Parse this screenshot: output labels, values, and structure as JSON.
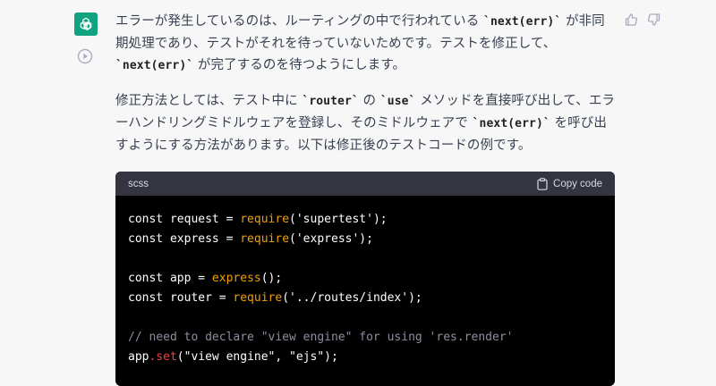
{
  "colors": {
    "accent": "#10a37f",
    "code_bg": "#000000",
    "code_header_bg": "#343541",
    "fn": "#f0a000",
    "method": "#ef4146",
    "comment": "#8e8ea0"
  },
  "icons": [
    "openai-logo-icon",
    "play-icon",
    "thumbs-up-icon",
    "thumbs-down-icon",
    "clipboard-icon"
  ],
  "message": {
    "p1": [
      {
        "t": "エラーが発生しているのは、ルーティングの中で行われている "
      },
      {
        "c": "`next(err)`"
      },
      {
        "t": " が非同期処理であり、テストがそれを待っていないためです。テストを修正して、 "
      },
      {
        "c": "`next(err)`"
      },
      {
        "t": " が完了するのを待つようにします。"
      }
    ],
    "p2": [
      {
        "t": "修正方法としては、テスト中に "
      },
      {
        "c": "`router`"
      },
      {
        "t": " の "
      },
      {
        "c": "`use`"
      },
      {
        "t": " メソッドを直接呼び出して、エラーハンドリングミドルウェアを登録し、そのミドルウェアで "
      },
      {
        "c": "`next(err)`"
      },
      {
        "t": " を呼び出すようにする方法があります。以下は修正後のテストコードの例です。"
      }
    ]
  },
  "codeblock": {
    "language": "scss",
    "copy_label": "Copy code",
    "lines": [
      [
        {
          "t": "const request = "
        },
        {
          "f": "require"
        },
        {
          "t": "('supertest');"
        }
      ],
      [
        {
          "t": "const express = "
        },
        {
          "f": "require"
        },
        {
          "t": "('express');"
        }
      ],
      [],
      [
        {
          "t": "const app = "
        },
        {
          "f": "express"
        },
        {
          "t": "();"
        }
      ],
      [
        {
          "t": "const router = "
        },
        {
          "f": "require"
        },
        {
          "t": "('../routes/index');"
        }
      ],
      [],
      [
        {
          "cm": "// need to declare \"view engine\" for using 'res.render'"
        }
      ],
      [
        {
          "t": "app"
        },
        {
          "r": ".set"
        },
        {
          "t": "(\"view engine\", \"ejs\");"
        }
      ]
    ]
  }
}
